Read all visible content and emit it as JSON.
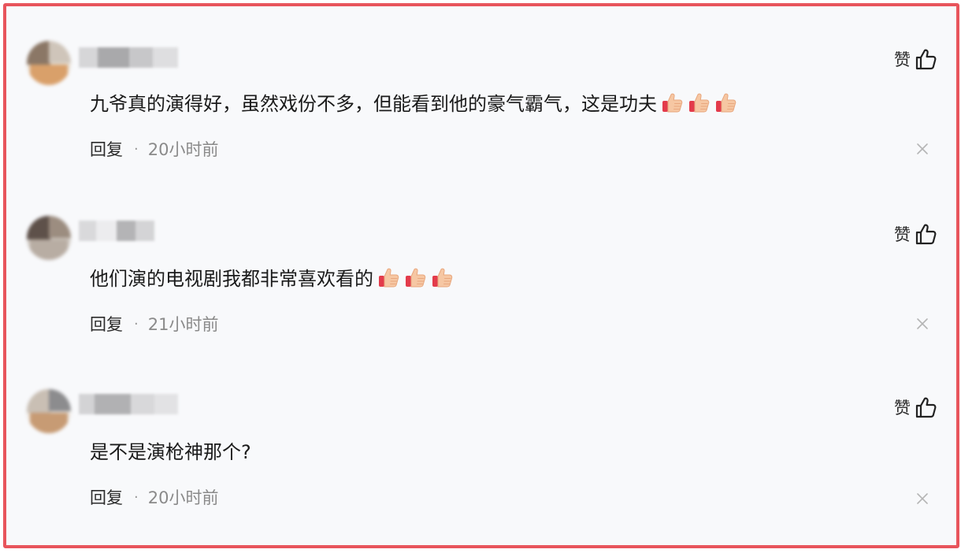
{
  "comments": [
    {
      "content": "九爷真的演得好，虽然戏份不多，但能看到他的豪气霸气，这是功夫",
      "emoji_icon": "thumbs-up-emoji",
      "emoji_count": 3,
      "like_label": "赞",
      "reply_label": "回复",
      "separator": "·",
      "time": "20小时前"
    },
    {
      "content": "他们演的电视剧我都非常喜欢看的",
      "emoji_icon": "thumbs-up-emoji",
      "emoji_count": 3,
      "like_label": "赞",
      "reply_label": "回复",
      "separator": "·",
      "time": "21小时前"
    },
    {
      "content": "是不是演枪神那个?",
      "emoji_icon": null,
      "emoji_count": 0,
      "like_label": "赞",
      "reply_label": "回复",
      "separator": "·",
      "time": "20小时前"
    }
  ],
  "colors": {
    "frame_border": "#e8555c",
    "background": "#f8f9fb",
    "text": "#1a1a1a",
    "muted": "#8a8a8a"
  },
  "icons": {
    "like": "thumbs-up-outline-icon",
    "dismiss": "close-icon",
    "emoji": "thumbs-up-emoji"
  }
}
